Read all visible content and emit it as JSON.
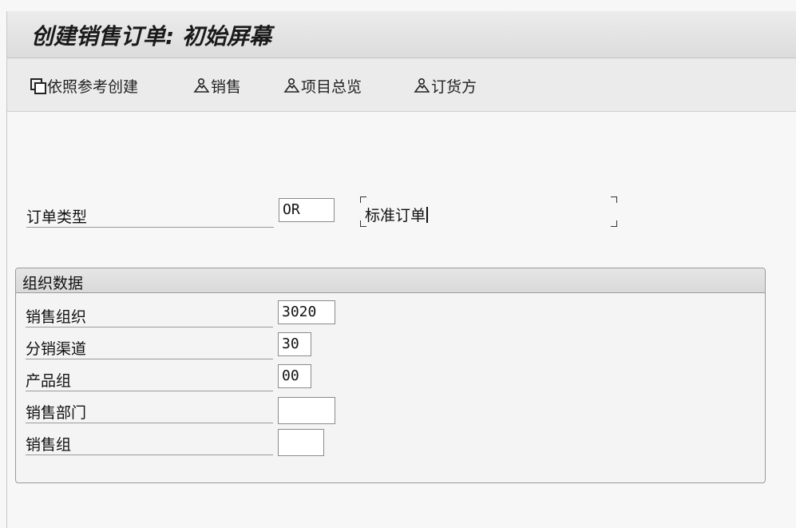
{
  "window": {
    "title": "创建销售订单: 初始屏幕"
  },
  "toolbar": {
    "create_with_reference": "依照参考创建",
    "sales": "销售",
    "item_overview": "项目总览",
    "sold_to_party": "订货方"
  },
  "order_type": {
    "label": "订单类型",
    "value": "OR",
    "description": "标准订单"
  },
  "org_data": {
    "title": "组织数据",
    "fields": [
      {
        "label": "销售组织",
        "value": "3020"
      },
      {
        "label": "分销渠道",
        "value": "30"
      },
      {
        "label": "产品组",
        "value": "00"
      },
      {
        "label": "销售部门",
        "value": ""
      },
      {
        "label": "销售组",
        "value": ""
      }
    ]
  }
}
